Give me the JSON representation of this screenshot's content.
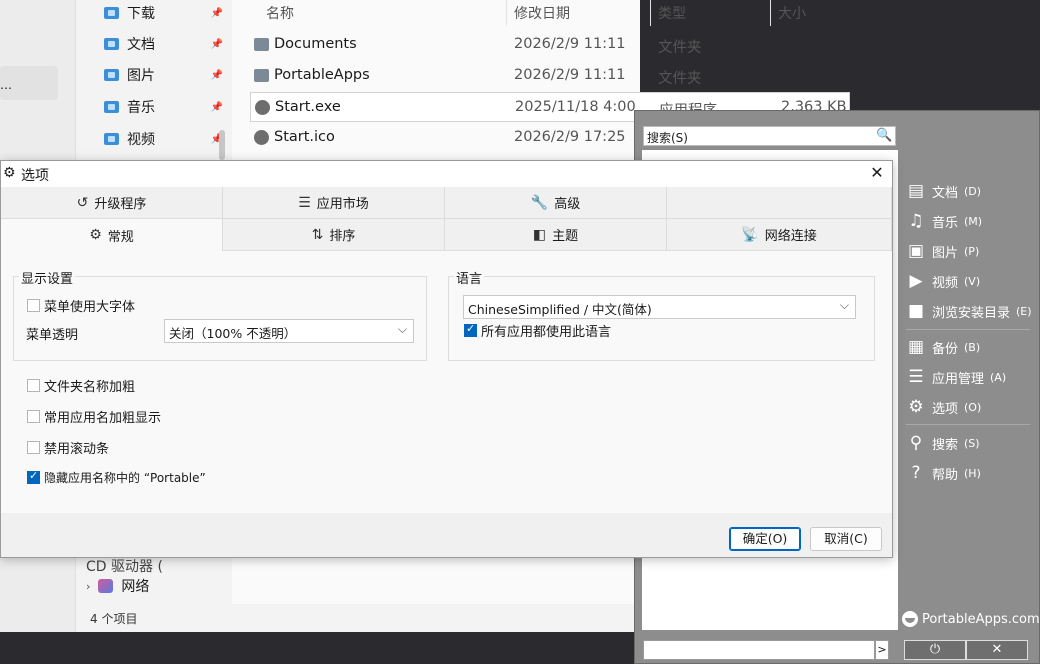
{
  "explorer": {
    "nav_items": [
      {
        "label": "下载"
      },
      {
        "label": "文档"
      },
      {
        "label": "图片"
      },
      {
        "label": "音乐"
      },
      {
        "label": "视频"
      }
    ],
    "left_dots": "…",
    "network": "网络",
    "hidden_item": "CD 驱动器 (",
    "status": "4 个项目",
    "columns": {
      "name": "名称",
      "date": "修改日期",
      "type": "类型",
      "size": "大小"
    },
    "files": [
      {
        "name": "Documents",
        "date": "2026/2/9 11:11",
        "type": "文件夹",
        "size": ""
      },
      {
        "name": "PortableApps",
        "date": "2026/2/9 11:11",
        "type": "文件夹",
        "size": ""
      },
      {
        "name": "Start.exe",
        "date": "2025/11/18 4:00",
        "type": "应用程序",
        "size": "2,363 KB"
      },
      {
        "name": "Start.ico",
        "date": "2026/2/9 17:25",
        "type": "",
        "size": ""
      }
    ]
  },
  "portableapps": {
    "search_placeholder": "搜索(S)",
    "items": [
      {
        "label": "文档",
        "key": "(D)",
        "icon": "documents-icon"
      },
      {
        "label": "音乐",
        "key": "(M)",
        "icon": "music-icon"
      },
      {
        "label": "图片",
        "key": "(P)",
        "icon": "pictures-icon"
      },
      {
        "label": "视频",
        "key": "(V)",
        "icon": "videos-icon"
      },
      {
        "label": "浏览安装目录",
        "key": "(E)",
        "icon": "folder-icon"
      },
      {
        "label": "备份",
        "key": "(B)",
        "icon": "backup-icon"
      },
      {
        "label": "应用管理",
        "key": "(A)",
        "icon": "apps-icon"
      },
      {
        "label": "选项",
        "key": "(O)",
        "icon": "gear-icon"
      },
      {
        "label": "搜索",
        "key": "(S)",
        "icon": "search-icon"
      },
      {
        "label": "帮助",
        "key": "(H)",
        "icon": "help-icon"
      }
    ],
    "brand": "PortableApps.com",
    "bottom_arrow": ">",
    "power_glyph": "⏻",
    "close_glyph": "✕"
  },
  "dialog": {
    "title": "选项",
    "tabs_row1": [
      {
        "label": "升级程序",
        "icon": "history-icon"
      },
      {
        "label": "应用市场",
        "icon": "list-icon"
      },
      {
        "label": "高级",
        "icon": "wrench-icon"
      }
    ],
    "tabs_row2": [
      {
        "label": "常规",
        "icon": "gear-icon"
      },
      {
        "label": "排序",
        "icon": "sort-icon"
      },
      {
        "label": "主题",
        "icon": "theme-icon"
      },
      {
        "label": "网络连接",
        "icon": "network-icon"
      }
    ],
    "display_group": {
      "title": "显示设置",
      "large_font": {
        "label": "菜单使用大字体",
        "checked": false
      },
      "transparency_label": "菜单透明",
      "transparency_value": "关闭（100% 不透明）"
    },
    "language_group": {
      "title": "语言",
      "value": "ChineseSimplified / 中文(简体)",
      "all_apps": {
        "label": "所有应用都使用此语言",
        "checked": true
      }
    },
    "options": [
      {
        "label": "文件夹名称加粗",
        "checked": false
      },
      {
        "label": "常用应用名加粗显示",
        "checked": false
      },
      {
        "label": "禁用滚动条",
        "checked": false
      },
      {
        "label": "隐藏应用名称中的 “Portable”",
        "checked": true
      }
    ],
    "ok": "确定(O)",
    "cancel": "取消(C)"
  }
}
